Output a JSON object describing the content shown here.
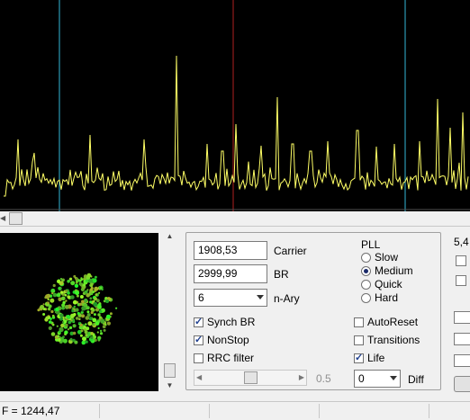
{
  "carrier": {
    "value": "1908,53",
    "label": "Carrier"
  },
  "baud_rate": {
    "value": "2999,99",
    "label": "BR"
  },
  "n_ary": {
    "value": "6",
    "label": "n-Ary"
  },
  "pll": {
    "title": "PLL",
    "options": [
      "Slow",
      "Medium",
      "Quick",
      "Hard"
    ],
    "selected": "Medium"
  },
  "checkboxes": {
    "synch_br": {
      "label": "Synch BR",
      "checked": true
    },
    "nonstop": {
      "label": "NonStop",
      "checked": true
    },
    "rrc_filter": {
      "label": "RRC filter",
      "checked": false
    },
    "autoreset": {
      "label": "AutoReset",
      "checked": false
    },
    "transitions": {
      "label": "Transitions",
      "checked": false
    },
    "life": {
      "label": "Life",
      "checked": true
    }
  },
  "rolloff": {
    "value": "0.5"
  },
  "diff": {
    "value": "0",
    "label": "Diff"
  },
  "side_readout": "5,4",
  "status": {
    "frequency": "F = 1244,47"
  },
  "colors": {
    "trace": "#ffff66",
    "marker_cyan": "#33b8d8",
    "marker_red": "#b02020",
    "constellation": "#33dd33"
  }
}
